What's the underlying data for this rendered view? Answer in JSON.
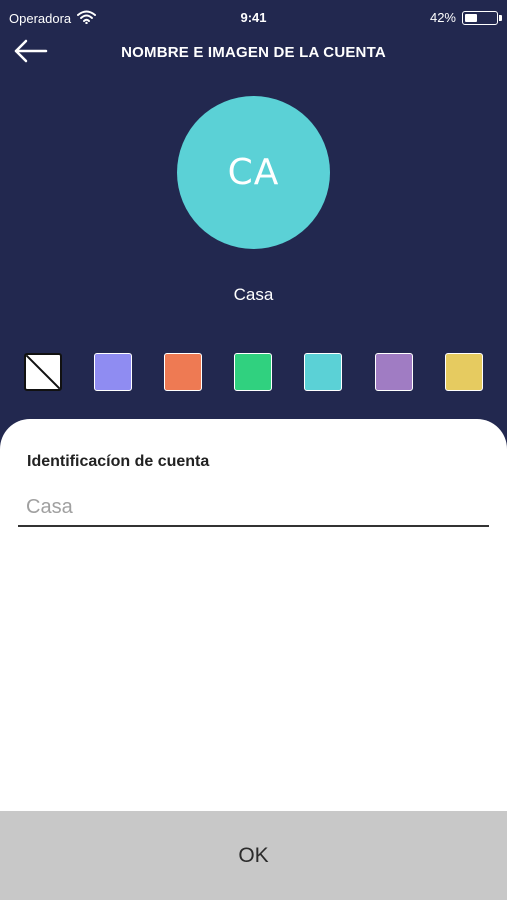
{
  "status_bar": {
    "carrier": "Operadora",
    "time": "9:41",
    "battery_percent": "42%",
    "battery_level": 0.42,
    "wifi_icon": "wifi-icon"
  },
  "header": {
    "back_icon": "arrow-left-icon",
    "title": "NOMBRE E IMAGEN DE LA CUENTA"
  },
  "avatar": {
    "initials": "CA",
    "color": "#5bd1d6"
  },
  "account_name": "Casa",
  "swatches": [
    {
      "name": "none",
      "color": "#ffffff"
    },
    {
      "name": "periwinkle",
      "color": "#8f8cf2"
    },
    {
      "name": "orange",
      "color": "#ee7a53"
    },
    {
      "name": "green",
      "color": "#30d17f"
    },
    {
      "name": "turquoise",
      "color": "#5bd1d6"
    },
    {
      "name": "purple",
      "color": "#a07cc3"
    },
    {
      "name": "yellow",
      "color": "#e6cb60"
    }
  ],
  "form": {
    "label": "Identificacíon de cuenta",
    "value": "",
    "placeholder": "Casa"
  },
  "ok_button": {
    "label": "OK"
  },
  "colors": {
    "background": "#22284f",
    "card": "#ffffff",
    "button": "#c8c8c8"
  }
}
